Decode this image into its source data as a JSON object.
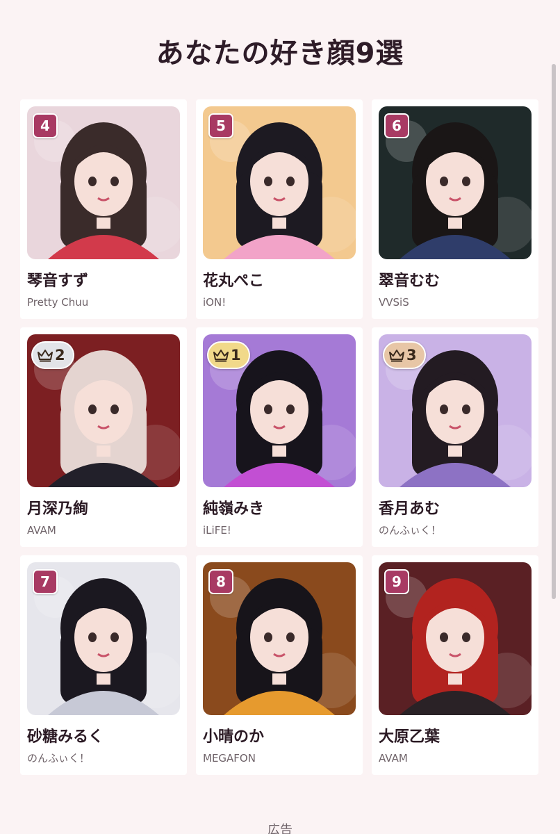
{
  "page": {
    "title": "あなたの好き顔9選",
    "ad_label": "広告",
    "accent_color": "#a83a63"
  },
  "cards": [
    {
      "rank": "4",
      "name": "琴音すず",
      "group": "Pretty Chuu",
      "badge_type": "number",
      "bg": "#e9d6dc",
      "hair": "#3a2b2a",
      "accent": "#d23a4b"
    },
    {
      "rank": "5",
      "name": "花丸ぺこ",
      "group": "iON!",
      "badge_type": "number",
      "bg": "#f3c98f",
      "hair": "#1d1a22",
      "accent": "#f2a3c8"
    },
    {
      "rank": "6",
      "name": "翠音むむ",
      "group": "VVSiS",
      "badge_type": "number",
      "bg": "#1f2a2a",
      "hair": "#1a1616",
      "accent": "#2f3d6a"
    },
    {
      "rank": "2",
      "name": "月深乃絢",
      "group": "AVAM",
      "badge_type": "crown",
      "medal": "silver",
      "bg": "#7c1f22",
      "hair": "#e4d4d0",
      "accent": "#22202a"
    },
    {
      "rank": "1",
      "name": "純嶺みき",
      "group": "iLiFE!",
      "badge_type": "crown",
      "medal": "gold",
      "bg": "#a57ad6",
      "hair": "#17141c",
      "accent": "#c24fd3"
    },
    {
      "rank": "3",
      "name": "香月あむ",
      "group": "のんふぃく！",
      "badge_type": "crown",
      "medal": "bronze",
      "bg": "#c9b2e6",
      "hair": "#231b22",
      "accent": "#8d72c4"
    },
    {
      "rank": "7",
      "name": "砂糖みるく",
      "group": "のんふぃく！",
      "badge_type": "number",
      "bg": "#e6e6ec",
      "hair": "#1b1820",
      "accent": "#c7c9d6"
    },
    {
      "rank": "8",
      "name": "小晴のか",
      "group": "MEGAFON",
      "badge_type": "number",
      "bg": "#8a4a1d",
      "hair": "#17141a",
      "accent": "#e69a2e"
    },
    {
      "rank": "9",
      "name": "大原乙葉",
      "group": "AVAM",
      "badge_type": "number",
      "bg": "#5a2024",
      "hair": "#b2231f",
      "accent": "#2a2226"
    }
  ]
}
